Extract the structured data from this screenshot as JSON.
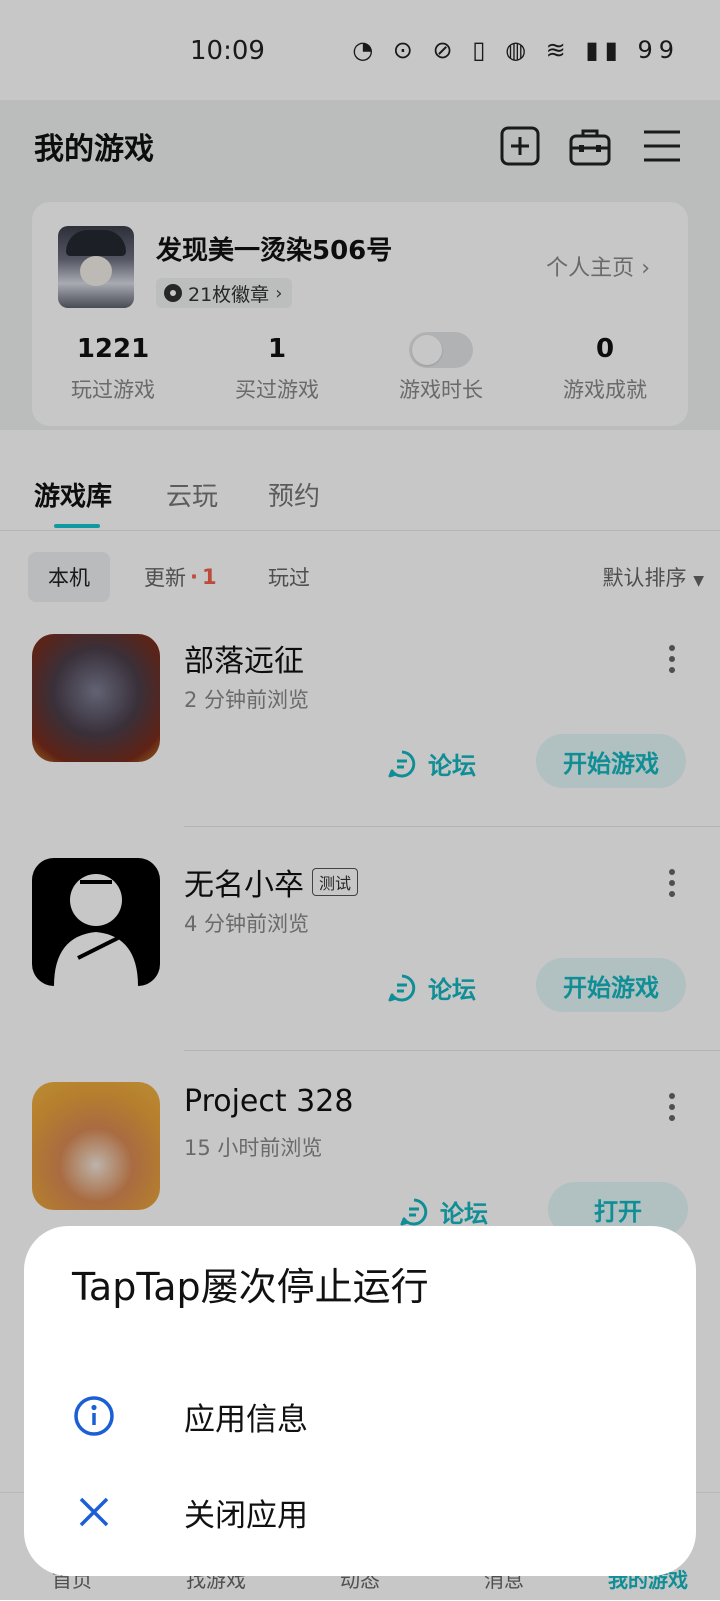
{
  "status_bar": {
    "time": "10:09",
    "icons_text": "◔ ⊙ ⊘ ▯ ◍ ≋ ▮▮ 99"
  },
  "header": {
    "title": "我的游戏"
  },
  "profile": {
    "username": "发现美一烫染506号",
    "badges": "21枚徽章",
    "homepage_link": "个人主页",
    "stats": [
      {
        "value": "1221",
        "label": "玩过游戏"
      },
      {
        "value": "1",
        "label": "买过游戏"
      },
      {
        "value": "",
        "label": "游戏时长"
      },
      {
        "value": "0",
        "label": "游戏成就"
      }
    ]
  },
  "tabs": [
    {
      "label": "游戏库",
      "active": true
    },
    {
      "label": "云玩",
      "active": false
    },
    {
      "label": "预约",
      "active": false
    }
  ],
  "filters": {
    "chips": [
      {
        "label": "本机",
        "active": true
      },
      {
        "label": "更新",
        "count": "1"
      },
      {
        "label": "玩过"
      }
    ],
    "sort_label": "默认排序"
  },
  "games": [
    {
      "name": "部落远征",
      "tag": "",
      "meta": "2 分钟前浏览",
      "forum_label": "论坛",
      "action_label": "开始游戏"
    },
    {
      "name": "无名小卒",
      "tag": "测试",
      "meta": "4 分钟前浏览",
      "forum_label": "论坛",
      "action_label": "开始游戏"
    },
    {
      "name": "Project 328",
      "tag": "",
      "meta": "15 小时前浏览",
      "forum_label": "论坛",
      "action_label": "打开"
    }
  ],
  "bottom_nav": [
    {
      "label": "首页",
      "active": false
    },
    {
      "label": "找游戏",
      "active": false
    },
    {
      "label": "动态",
      "active": false
    },
    {
      "label": "消息",
      "active": false
    },
    {
      "label": "我的游戏",
      "active": true
    }
  ],
  "dialog": {
    "title": "TapTap屡次停止运行",
    "items": [
      {
        "label": "应用信息",
        "icon": "info-icon"
      },
      {
        "label": "关闭应用",
        "icon": "close-icon"
      }
    ]
  },
  "colors": {
    "accent": "#15b7c1",
    "update_dot": "#f1604d",
    "dialog_icon": "#1a5fd6"
  }
}
